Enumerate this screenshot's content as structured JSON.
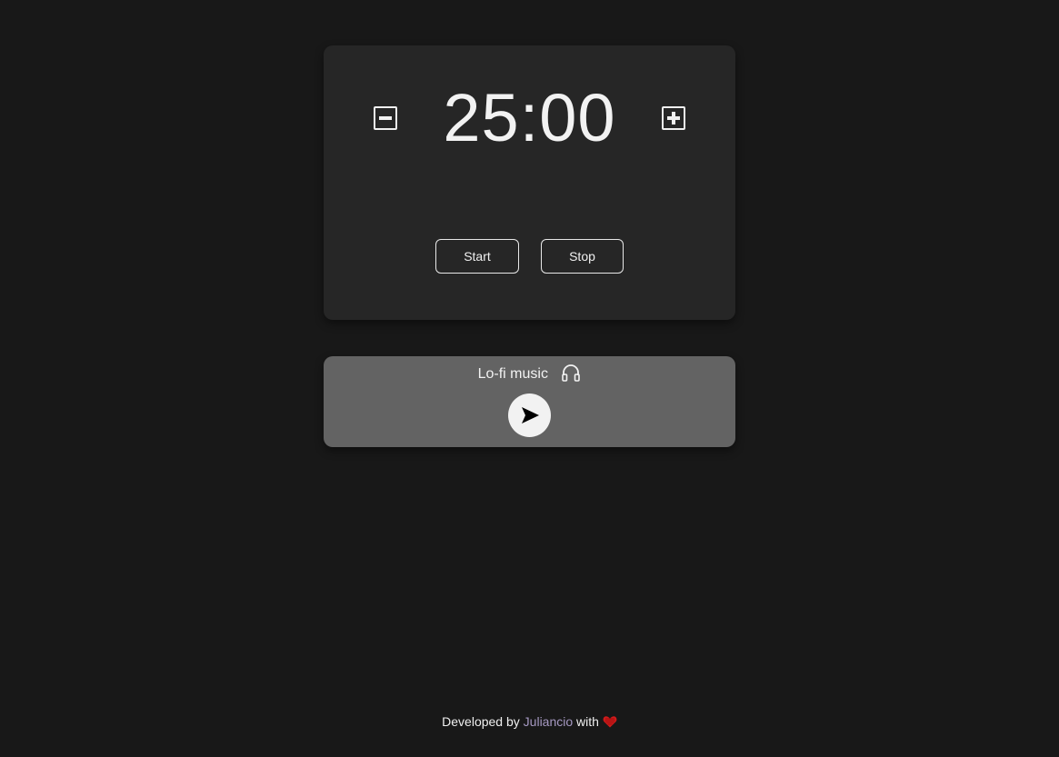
{
  "timer": {
    "time": "25:00",
    "decrease_icon": "minus-square-icon",
    "increase_icon": "plus-square-icon",
    "start_label": "Start",
    "stop_label": "Stop"
  },
  "music": {
    "title": "Lo-fi music",
    "title_icon": "headphones-icon",
    "play_icon": "play-icon"
  },
  "footer": {
    "prefix": "Developed by",
    "author": "Juliancio",
    "suffix": "with",
    "icon": "heart-icon"
  },
  "colors": {
    "background": "#181818",
    "card": "#262626",
    "music_card": "#636363",
    "author_link": "#a699c2",
    "heart": "#d11a1a"
  }
}
